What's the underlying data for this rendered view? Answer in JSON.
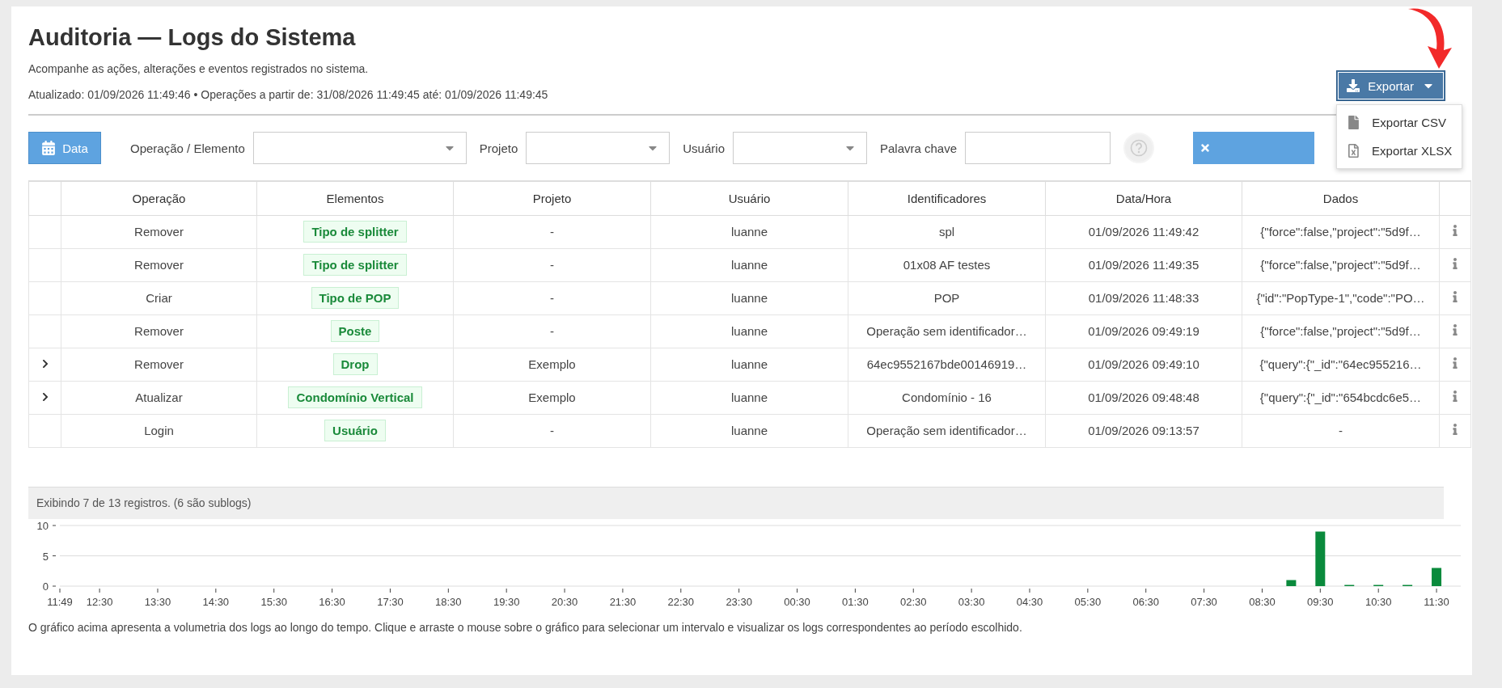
{
  "header": {
    "title": "Auditoria — Logs do Sistema",
    "subtitle": "Acompanhe as ações, alterações e eventos registrados no sistema.",
    "updated": "Atualizado: 01/09/2026 11:49:46 • Operações a partir de: 31/08/2026 11:49:45 até: 01/09/2026 11:49:45"
  },
  "export": {
    "label": "Exportar",
    "expanded": true,
    "menu": [
      {
        "kind": "csv",
        "label": "Exportar CSV"
      },
      {
        "kind": "xlsx",
        "label": "Exportar XLSX"
      }
    ]
  },
  "filters": {
    "date_button": "Data",
    "fields": [
      {
        "kind": "select",
        "label": "Operação / Elemento"
      },
      {
        "kind": "select",
        "label": "Projeto"
      },
      {
        "kind": "select",
        "label": "Usuário"
      },
      {
        "kind": "text",
        "label": "Palavra chave"
      }
    ]
  },
  "table": {
    "columns": [
      "Operação",
      "Elementos",
      "Projeto",
      "Usuário",
      "Identificadores",
      "Data/Hora",
      "Dados"
    ],
    "rows": [
      {
        "expandable": false,
        "cells": [
          "Remover",
          "Tipo de splitter",
          "-",
          "luanne",
          "spl",
          "01/09/2026 11:49:42",
          "{\"force\":false,\"project\":\"5d9f…"
        ]
      },
      {
        "expandable": false,
        "cells": [
          "Remover",
          "Tipo de splitter",
          "-",
          "luanne",
          "01x08 AF testes",
          "01/09/2026 11:49:35",
          "{\"force\":false,\"project\":\"5d9f…"
        ]
      },
      {
        "expandable": false,
        "cells": [
          "Criar",
          "Tipo de POP",
          "-",
          "luanne",
          "POP",
          "01/09/2026 11:48:33",
          "{\"id\":\"PopType-1\",\"code\":\"PO…"
        ]
      },
      {
        "expandable": false,
        "cells": [
          "Remover",
          "Poste",
          "-",
          "luanne",
          "Operação sem identificador…",
          "01/09/2026 09:49:19",
          "{\"force\":false,\"project\":\"5d9f…"
        ]
      },
      {
        "expandable": true,
        "cells": [
          "Remover",
          "Drop",
          "Exemplo",
          "luanne",
          "64ec9552167bde00146919…",
          "01/09/2026 09:49:10",
          "{\"query\":{\"_id\":\"64ec955216…"
        ]
      },
      {
        "expandable": true,
        "cells": [
          "Atualizar",
          "Condomínio Vertical",
          "Exemplo",
          "luanne",
          "Condomínio - 16",
          "01/09/2026 09:48:48",
          "{\"query\":{\"_id\":\"654bcdc6e5…"
        ]
      },
      {
        "expandable": false,
        "cells": [
          "Login",
          "Usuário",
          "-",
          "luanne",
          "Operação sem identificador…",
          "01/09/2026 09:13:57",
          "-"
        ]
      }
    ]
  },
  "status": "Exibindo 7 de 13 registros. (6 são sublogs)",
  "chart_data": {
    "type": "bar",
    "x": [
      "2026-09-01T09:00",
      "2026-09-01T09:30",
      "2026-09-01T10:00",
      "2026-09-01T10:30",
      "2026-09-01T11:00",
      "2026-09-01T11:30"
    ],
    "series": [
      {
        "color": "#0a8a3c",
        "values": [
          1,
          9,
          0,
          0,
          0,
          3
        ]
      }
    ],
    "xlim": [
      "2026-08-31T11:49",
      "2026-09-01T11:55"
    ],
    "ylim": [
      0,
      10
    ],
    "xticks": [
      {
        "value": "2026-08-31T11:49",
        "label": "11:49"
      },
      {
        "value": "2026-08-31T12:30",
        "label": "12:30"
      },
      {
        "value": "2026-08-31T13:30",
        "label": "13:30"
      },
      {
        "value": "2026-08-31T14:30",
        "label": "14:30"
      },
      {
        "value": "2026-08-31T15:30",
        "label": "15:30"
      },
      {
        "value": "2026-08-31T16:30",
        "label": "16:30"
      },
      {
        "value": "2026-08-31T17:30",
        "label": "17:30"
      },
      {
        "value": "2026-08-31T18:30",
        "label": "18:30"
      },
      {
        "value": "2026-08-31T19:30",
        "label": "19:30"
      },
      {
        "value": "2026-08-31T20:30",
        "label": "20:30"
      },
      {
        "value": "2026-08-31T21:30",
        "label": "21:30"
      },
      {
        "value": "2026-08-31T22:30",
        "label": "22:30"
      },
      {
        "value": "2026-08-31T23:30",
        "label": "23:30"
      },
      {
        "value": "2026-09-01T00:30",
        "label": "00:30"
      },
      {
        "value": "2026-09-01T01:30",
        "label": "01:30"
      },
      {
        "value": "2026-09-01T02:30",
        "label": "02:30"
      },
      {
        "value": "2026-09-01T03:30",
        "label": "03:30"
      },
      {
        "value": "2026-09-01T04:30",
        "label": "04:30"
      },
      {
        "value": "2026-09-01T05:30",
        "label": "05:30"
      },
      {
        "value": "2026-09-01T06:30",
        "label": "06:30"
      },
      {
        "value": "2026-09-01T07:30",
        "label": "07:30"
      },
      {
        "value": "2026-09-01T08:30",
        "label": "08:30"
      },
      {
        "value": "2026-09-01T09:30",
        "label": "09:30"
      },
      {
        "value": "2026-09-01T10:30",
        "label": "10:30"
      },
      {
        "value": "2026-09-01T11:30",
        "label": "11:30"
      }
    ],
    "yticks": [
      0,
      5,
      10
    ]
  },
  "caption": "O gráfico acima apresenta a volumetria dos logs ao longo do tempo. Clique e arraste o mouse sobre o gráfico para selecionar um intervalo e visualizar os logs correspondentes ao período escolhido."
}
